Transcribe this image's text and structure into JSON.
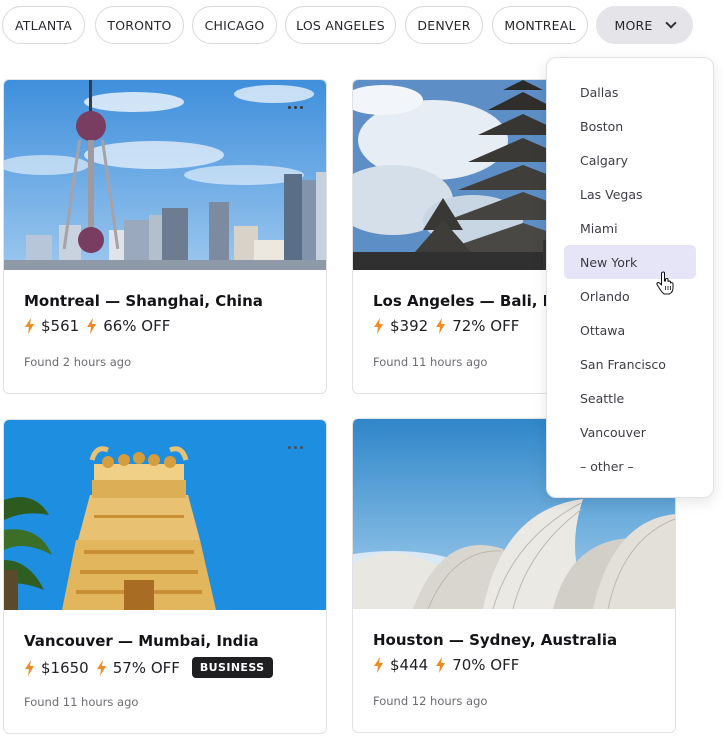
{
  "city_chips": [
    "ATLANTA",
    "TORONTO",
    "CHICAGO",
    "LOS ANGELES",
    "DENVER",
    "MONTREAL"
  ],
  "more_chip": {
    "label": "MORE",
    "icon": "chevron-down-icon"
  },
  "dropdown": {
    "items": [
      "Dallas",
      "Boston",
      "Calgary",
      "Las Vegas",
      "Miami",
      "New York",
      "Orlando",
      "Ottawa",
      "San Francisco",
      "Seattle",
      "Vancouver",
      "– other –"
    ],
    "hovered": "New York"
  },
  "deals": [
    {
      "route": "Montreal — Shanghai, China",
      "price": "$561",
      "discount": "66% OFF",
      "found": "Found 2 hours ago",
      "badge": ""
    },
    {
      "route": "Los Angeles — Bali, Indonesia",
      "price": "$392",
      "discount": "72% OFF",
      "found": "Found 11 hours ago",
      "badge": ""
    },
    {
      "route": "Vancouver — Mumbai, India",
      "price": "$1650",
      "discount": "57% OFF",
      "found": "Found 11 hours ago",
      "badge": "BUSINESS"
    },
    {
      "route": "Houston — Sydney, Australia",
      "price": "$444",
      "discount": "70% OFF",
      "found": "Found 12 hours ago",
      "badge": ""
    }
  ],
  "colors": {
    "accent_bolt": "#f08a24",
    "hover_bg": "#e5e5f7",
    "badge_bg": "#1f1f22"
  }
}
